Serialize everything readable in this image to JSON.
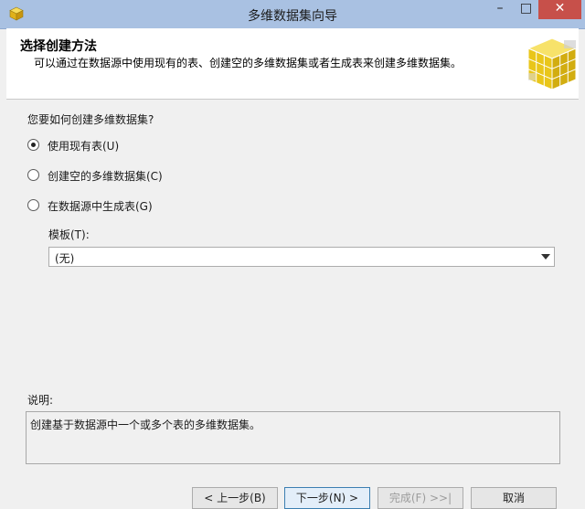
{
  "window": {
    "title": "多维数据集向导",
    "minimize_glyph": "–",
    "maximize_glyph": "□",
    "close_glyph": "✕",
    "app_icon": "cube-icon"
  },
  "header": {
    "title": "选择创建方法",
    "subtitle": "可以通过在数据源中使用现有的表、创建空的多维数据集或者生成表来创建多维数据集。",
    "graphic": "yellow-cube-icon"
  },
  "form": {
    "question": "您要如何创建多维数据集?",
    "options": [
      {
        "label": "使用现有表(U)",
        "selected": true
      },
      {
        "label": "创建空的多维数据集(C)",
        "selected": false
      },
      {
        "label": "在数据源中生成表(G)",
        "selected": false
      }
    ],
    "template_label": "模板(T):",
    "template_value": "(无)"
  },
  "description": {
    "label": "说明:",
    "text": "创建基于数据源中一个或多个表的多维数据集。"
  },
  "footer": {
    "prev_label": "< 上一步(B)",
    "next_label": "下一步(N) >",
    "finish_label": "完成(F) >>|",
    "cancel_label": "取消"
  },
  "colors": {
    "titlebar": "#a9c1e2",
    "close_button": "#c7504a",
    "cube_yellow": "#f2d21b"
  }
}
